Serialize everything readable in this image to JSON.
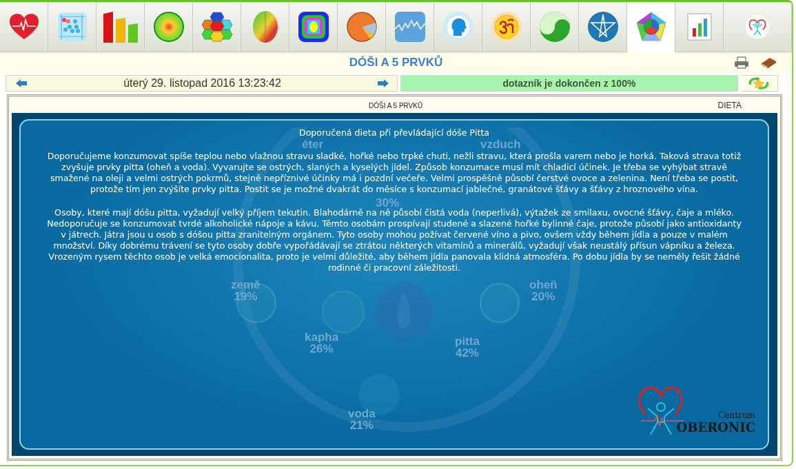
{
  "tabs": [
    {
      "kind": "heart",
      "selected": false
    },
    {
      "kind": "scatter",
      "selected": false
    },
    {
      "kind": "bars",
      "selected": false
    },
    {
      "kind": "sphere",
      "selected": false
    },
    {
      "kind": "hexagons",
      "selected": false
    },
    {
      "kind": "brain",
      "selected": false
    },
    {
      "kind": "pattern",
      "selected": false
    },
    {
      "kind": "pie",
      "selected": false
    },
    {
      "kind": "wave",
      "selected": false
    },
    {
      "kind": "head",
      "selected": false
    },
    {
      "kind": "sun",
      "selected": false
    },
    {
      "kind": "yinyang",
      "selected": false
    },
    {
      "kind": "star",
      "selected": false
    },
    {
      "kind": "pentagon",
      "selected": true
    },
    {
      "kind": "chart",
      "selected": false
    },
    {
      "kind": "logo",
      "selected": false
    }
  ],
  "page_title": "DÓŠI A 5 PRVKŮ",
  "date": "úterý 29. listopad 2016 13:23:42",
  "progress": {
    "label": "dotazník je dokončen z 100%",
    "level": 1
  },
  "panel": {
    "heading": "DÓŠI A 5 PRVKŮ",
    "section": "DIETA"
  },
  "diet": {
    "title": "Doporučená dieta při převládající dóše Pitta",
    "paragraphs": [
      "Doporučujeme konzumovat spíše teplou nebo vlažnou stravu sladké, hořké nebo trpké chuti, nežli stravu, která prošla varem nebo je horká. Taková strava totiž zvyšuje prvky pitta (oheň a voda). Vyvarujte se ostrých, slaných a kyselých jídel. Způsob konzumace musí mít chladicí účinek. Je třeba se vyhýbat stravě smažené na oleji a velmi ostrých pokrmů, stejně nepříznivé účinky má i pozdní večeře. Velmi prospěšně působí čerstvé ovoce a zelenina. Není třeba se postit, protože tím jen zvýšíte prvky pitta. Postit se je možné dvakrát do měsíce s konzumací jablečné, granátové šťávy a šťávy z hroznového vína.",
      "Osoby, které mají dóšu pitta, vyžadují velký příjem tekutin. Blahodárně na ně působí čistá voda (neperlivá), výtažek ze smilaxu, ovocné šťávy, čaje a mléko. Nedoporučuje se konzumovat tvrdé alkoholické nápoje a kávu. Těmto osobám prospívají studené a slazené hořké bylinné čaje, protože působí jako antioxidanty v játrech. Játra jsou u osob s dóšou pitta zranitelným orgánem. Tyto osoby mohou požívat červené víno a pivo, ovšem vždy během jídla a pouze v malém množství. Díky dobrému trávení se tyto osoby dobře vypořádávají se ztrátou některých vitamínů a minerálů, vyžadují však neustálý přísun vápníku a železa. Vrozeným rysem těchto osob je velká emocionalita, proto je velmi důležité, aby během jídla panovala klidná atmosféra. Po dobu jídla by se neměly řešit žádné rodinné či pracovní záležitosti."
    ]
  },
  "diagram_labels": [
    {
      "name": "éter"
    },
    {
      "name": "vzduch"
    },
    {
      "value": "30%"
    },
    {
      "name": "země",
      "value": "19%"
    },
    {
      "name": "oheň",
      "value": "20%"
    },
    {
      "name": "kapha",
      "value": "26%"
    },
    {
      "name": "pitta",
      "value": "42%"
    },
    {
      "name": "voda",
      "value": "21%"
    }
  ],
  "logo": {
    "small": "Centrum",
    "name": "OBERONIC"
  }
}
